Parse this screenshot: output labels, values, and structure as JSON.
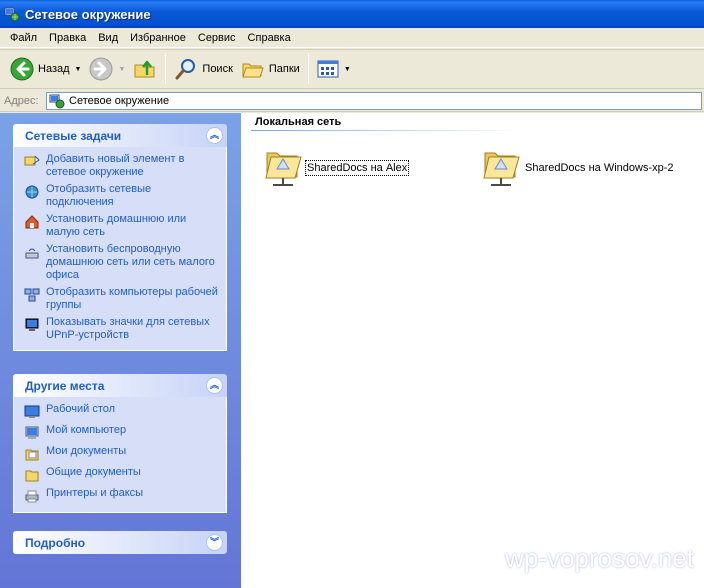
{
  "window": {
    "title": "Сетевое окружение"
  },
  "menu": [
    "Файл",
    "Правка",
    "Вид",
    "Избранное",
    "Сервис",
    "Справка"
  ],
  "toolbar": {
    "back_label": "Назад",
    "search_label": "Поиск",
    "folders_label": "Папки"
  },
  "address": {
    "label": "Адрес:",
    "value": "Сетевое окружение"
  },
  "network_tasks": {
    "title": "Сетевые задачи",
    "items": [
      {
        "label": "Добавить новый элемент в сетевое окружение",
        "icon": "add-network-place-icon"
      },
      {
        "label": "Отобразить сетевые подключения",
        "icon": "network-connections-icon"
      },
      {
        "label": "Установить домашнюю или малую сеть",
        "icon": "home-network-icon"
      },
      {
        "label": "Установить беспроводную домашнюю сеть или сеть малого офиса",
        "icon": "wireless-network-icon"
      },
      {
        "label": "Отобразить компьютеры рабочей группы",
        "icon": "workgroup-icon"
      },
      {
        "label": "Показывать значки для сетевых UPnP-устройств",
        "icon": "upnp-icon"
      }
    ]
  },
  "other_places": {
    "title": "Другие места",
    "items": [
      {
        "label": "Рабочий стол",
        "icon": "desktop-icon"
      },
      {
        "label": "Мой компьютер",
        "icon": "my-computer-icon"
      },
      {
        "label": "Мои документы",
        "icon": "my-documents-icon"
      },
      {
        "label": "Общие документы",
        "icon": "shared-documents-icon"
      },
      {
        "label": "Принтеры и факсы",
        "icon": "printers-icon"
      }
    ]
  },
  "details": {
    "title": "Подробно"
  },
  "content": {
    "group_title": "Локальная сеть",
    "items": [
      {
        "label": "SharedDocs на Alex",
        "focused": true
      },
      {
        "label": "SharedDocs на Windows-xp-2",
        "focused": false
      }
    ]
  },
  "watermark": "wp-voprosov.net",
  "colors": {
    "titlebar": "#0a5ad8",
    "taskpane": "#7ba2e7",
    "link": "#215dc6"
  }
}
